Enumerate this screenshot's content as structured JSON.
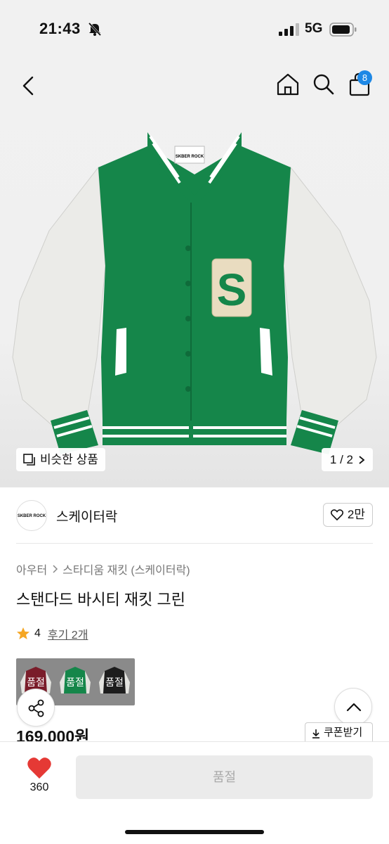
{
  "status_bar": {
    "time": "21:43",
    "network": "5G"
  },
  "header": {
    "cart_count": "8"
  },
  "gallery": {
    "similar_label": "비슷한 상품",
    "pager_label": "1 / 2",
    "tag_text": "SKBER ROCK",
    "patch_letter": "S",
    "jacket_colors": {
      "body": "#15864a",
      "sleeves": "#ececea",
      "patch": "#e9dcc0"
    }
  },
  "brand": {
    "name": "스케이터락",
    "logo_text": "SKBER ROCK",
    "likes": "2만"
  },
  "breadcrumb": [
    "아우터",
    "스타디움 재킷 (스케이터락)"
  ],
  "product": {
    "title": "스탠다드 바시티 재킷 그린",
    "rating": "4",
    "review_label": "후기 2개",
    "price": "169,000원"
  },
  "swatches": [
    {
      "label": "품절",
      "color": "#7a1d2a"
    },
    {
      "label": "품절",
      "color": "#15864a"
    },
    {
      "label": "품절",
      "color": "#1d1d1d"
    }
  ],
  "coupon_label": "쿠폰받기",
  "bottom": {
    "like_count": "360",
    "buy_label": "품절"
  },
  "colors": {
    "accent": "#1e88e5",
    "heart": "#e53935",
    "star": "#f5a623"
  }
}
